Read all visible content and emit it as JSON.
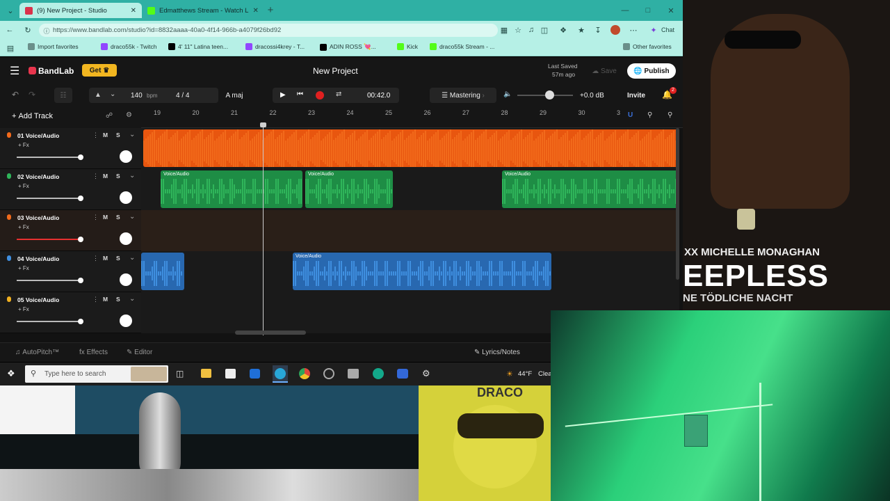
{
  "browser": {
    "tabs": [
      {
        "label": "(9) New Project - Studio",
        "active": true,
        "favicon": "#d9334b"
      },
      {
        "label": "Edmatthews Stream - Watch L",
        "active": false,
        "favicon": "#53fc18"
      }
    ],
    "new_tab": "+",
    "url": "https://www.bandlab.com/studio?id=8832aaaa-40a0-4f14-966b-a4079f26bd92",
    "chat_label": "Chat",
    "bookmarks": [
      {
        "label": "Import favorites",
        "color": "#6a8f8a"
      },
      {
        "label": "draco55k - Twitch",
        "color": "#9146ff"
      },
      {
        "label": "4' 11\" Latina teen...",
        "color": "#000000",
        "prefix": "X"
      },
      {
        "label": "dracossi4krey - T...",
        "color": "#9146ff"
      },
      {
        "label": "ADIN ROSS 💘...",
        "color": "#000000",
        "prefix": "X"
      },
      {
        "label": "Kick",
        "color": "#53fc18"
      },
      {
        "label": "draco55k Stream - ...",
        "color": "#53fc18"
      }
    ],
    "other_favorites": "Other favorites"
  },
  "app": {
    "brand": "BandLab",
    "get_button": "Get",
    "project_title": "New Project",
    "last_saved_line1": "Last Saved",
    "last_saved_line2": "57m ago",
    "save_label": "Save",
    "publish_label": "Publish",
    "bpm_value": "140",
    "bpm_unit": "bpm",
    "time_signature": "4 / 4",
    "key": "A maj",
    "time_display": "00:42.0",
    "mastering_label": "Mastering",
    "volume_db": "+0.0 dB",
    "invite_label": "Invite",
    "notification_count": "2",
    "add_track_label": "Add Track",
    "ruler": [
      "19",
      "20",
      "21",
      "22",
      "23",
      "24",
      "25",
      "26",
      "27",
      "28",
      "29",
      "30",
      "3"
    ],
    "tracks": [
      {
        "name": "01 Voice/Audio",
        "fx": "+ Fx",
        "color": "#f26a1b",
        "volume": 0.85
      },
      {
        "name": "02 Voice/Audio",
        "fx": "+ Fx",
        "color": "#2fb55a",
        "volume": 0.85
      },
      {
        "name": "03 Voice/Audio",
        "fx": "+ Fx",
        "color": "#f26a1b",
        "volume": 0.85
      },
      {
        "name": "04 Voice/Audio",
        "fx": "+ Fx",
        "color": "#3f8fe0",
        "volume": 0.85
      },
      {
        "name": "05 Voice/Audio",
        "fx": "+ Fx",
        "color": "#f0b020",
        "volume": 0.85
      }
    ],
    "mute_label": "M",
    "solo_label": "S",
    "clip_label": "Voice/Audio",
    "autopitch_label": "AutoPitch™",
    "effects_label": "Effects",
    "editor_label": "Editor",
    "lyrics_label": "Lyrics/Notes"
  },
  "taskbar": {
    "search_placeholder": "Type here to search",
    "weather": "44°F",
    "weather_extra": "Clea"
  },
  "overlays": {
    "poster_line1": "XX   MICHELLE MONAGHAN",
    "poster_line2": "EEPLESS",
    "poster_line3": "NE TÖDLICHE NACHT",
    "yellow_text": "DRACO"
  },
  "colors": {
    "accent": "#f2b620",
    "record": "#e02020",
    "teal": "#2fb0a4"
  }
}
